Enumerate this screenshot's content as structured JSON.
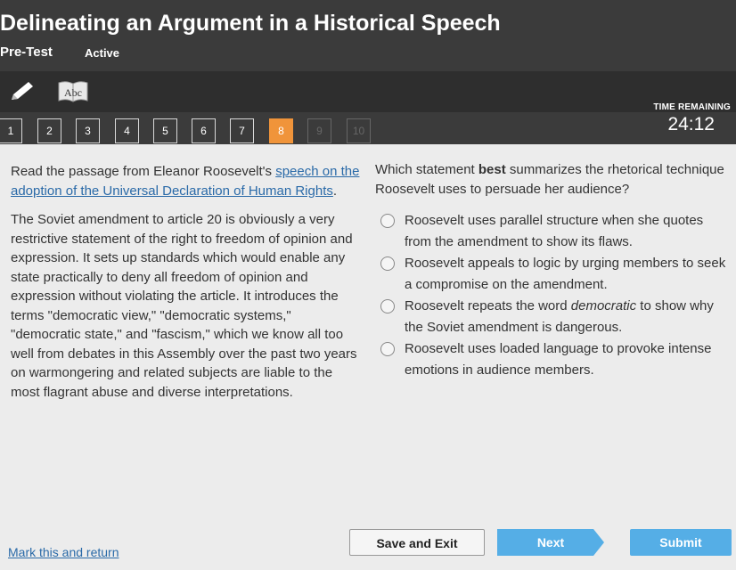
{
  "header": {
    "title": "Delineating an Argument in a Historical Speech",
    "subtitle": "Pre-Test",
    "status": "Active"
  },
  "toolbar": {
    "pencil_icon": "pencil-icon",
    "dictionary_icon": "abc-dictionary-icon",
    "dictionary_label": "Abc"
  },
  "question_nav": {
    "items": [
      "1",
      "2",
      "3",
      "4",
      "5",
      "6",
      "7",
      "8",
      "9",
      "10"
    ],
    "current": "8"
  },
  "timer": {
    "label": "TIME REMAINING",
    "value": "24:12"
  },
  "passage": {
    "intro_prefix": "Read the passage from Eleanor Roosevelt's ",
    "intro_link": "speech on the adoption of the Universal Declaration of Human Rights",
    "intro_suffix": ".",
    "text": "The Soviet amendment to article 20 is obviously a very restrictive statement of the right to freedom of opinion and expression. It sets up standards which would enable any state practically to deny all freedom of opinion and expression without violating the article. It introduces the terms \"democratic view,\" \"democratic systems,\" \"democratic state,\" and \"fascism,\" which we know all too well from debates in this Assembly over the past two years on warmongering and related subjects are liable to the most flagrant abuse and diverse interpretations."
  },
  "question": {
    "prefix": "Which statement ",
    "emphasis": "best",
    "suffix": " summarizes the rhetorical technique Roosevelt uses to persuade her audience?",
    "options": [
      {
        "text": "Roosevelt uses parallel structure when she quotes from the amendment to show its flaws."
      },
      {
        "text": "Roosevelt appeals to logic by urging members to seek a compromise on the amendment."
      },
      {
        "prefix": "Roosevelt repeats the word ",
        "emphasis": "democratic",
        "suffix": " to show why the Soviet amendment is dangerous."
      },
      {
        "text": "Roosevelt uses loaded language to provoke intense emotions in audience members."
      }
    ]
  },
  "footer": {
    "mark_label": "Mark this and return",
    "save_label": "Save and Exit",
    "next_label": "Next",
    "submit_label": "Submit"
  },
  "colors": {
    "header_bg": "#3b3b3b",
    "accent_orange": "#f0943a",
    "button_blue": "#55aee6",
    "link_blue": "#2a6aa8"
  }
}
